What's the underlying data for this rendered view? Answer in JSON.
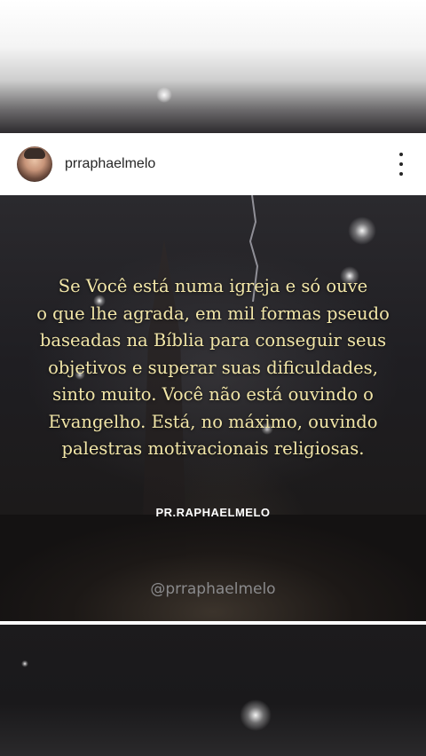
{
  "post": {
    "username": "prraphaelmelo",
    "avatar_icon": "profile-photo",
    "more_icon": "vertical-ellipsis-icon"
  },
  "image": {
    "quote_lines": [
      "Se Você está numa igreja e só ouve",
      "o que lhe agrada, em mil formas pseudo",
      "baseadas na Bíblia para conseguir seus",
      "objetivos e superar suas dificuldades,",
      "sinto muito. Você não está ouvindo o",
      "Evangelho. Está, no máximo, ouvindo",
      "palestras motivacionais religiosas."
    ],
    "author": "PR.RAPHAELMELO",
    "handle": "@prraphaelmelo",
    "quote_color": "#f2e6a8"
  }
}
